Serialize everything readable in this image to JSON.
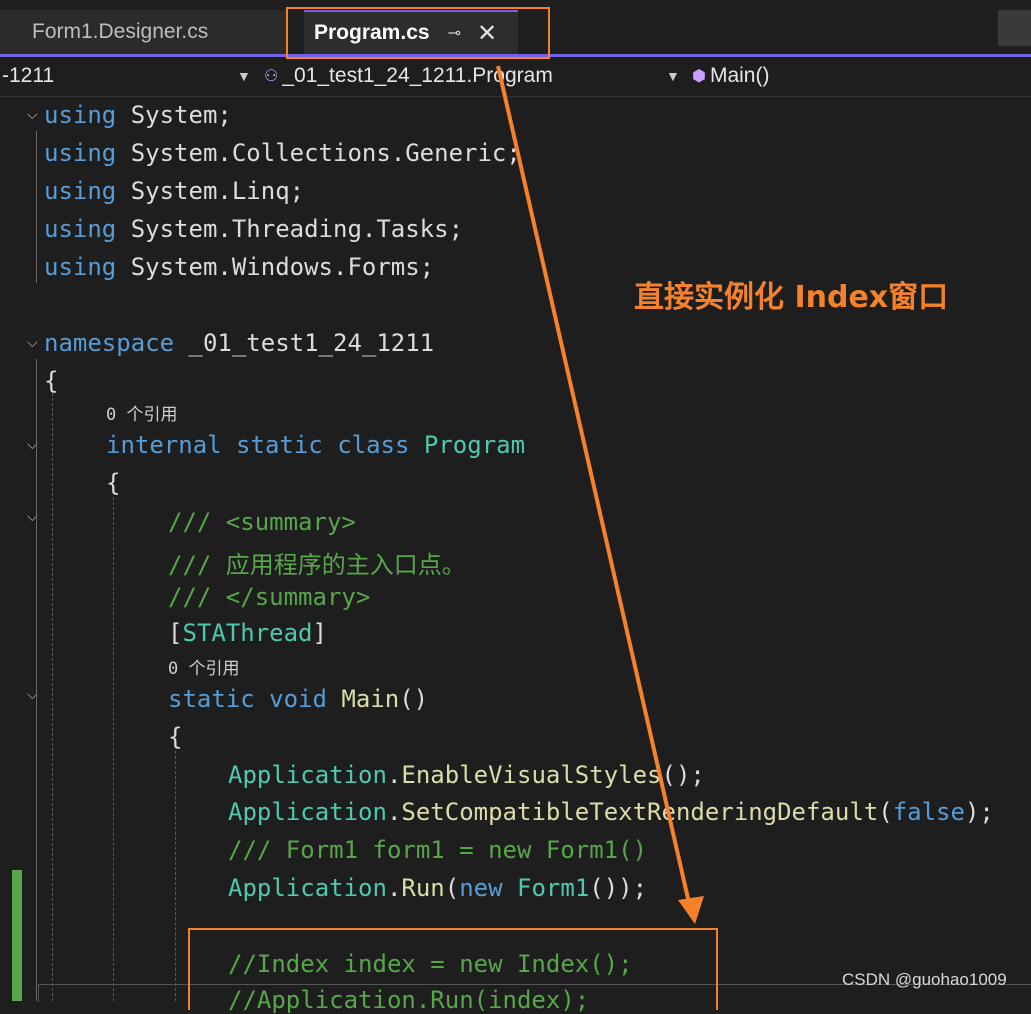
{
  "tabs": [
    {
      "label": "Form1.Designer.cs",
      "active": false
    },
    {
      "label": "Program.cs",
      "active": true,
      "pin_glyph": "⊸",
      "close_glyph": "✕"
    }
  ],
  "navbar": {
    "project": "-1211",
    "class_name": "_01_test1_24_1211.Program",
    "member": "Main()"
  },
  "code": {
    "l1_kw": "using",
    "l1_rest": " System;",
    "l2_kw": "using",
    "l2_rest": " System.Collections.Generic;",
    "l3_kw": "using",
    "l3_rest": " System.Linq;",
    "l4_kw": "using",
    "l4_rest": " System.Threading.Tasks;",
    "l5_kw": "using",
    "l5_rest": " System.Windows.Forms;",
    "ns_kw": "namespace",
    "ns_name": " _01_test1_24_1211",
    "brace_open": "{",
    "codelens_class": "0 个引用",
    "class_kw": "internal static class",
    "class_name": "Program",
    "class_brace": "{",
    "doc1": "/// <summary>",
    "doc2": "/// 应用程序的主入口点。",
    "doc3": "/// </summary>",
    "attr_open": "[",
    "attr_name": "STAThread",
    "attr_close": "]",
    "codelens_main": "0 个引用",
    "main_kw": "static void",
    "main_name": "Main",
    "main_parens": "()",
    "main_brace": "{",
    "s1_type": "Application",
    "s1_dot": ".",
    "s1_fn": "EnableVisualStyles",
    "s1_end": "();",
    "s2_type": "Application",
    "s2_dot": ".",
    "s2_fn": "SetCompatibleTextRenderingDefault",
    "s2_open": "(",
    "s2_arg": "false",
    "s2_end": ");",
    "s3_comment": "/// Form1 form1 = new Form1()",
    "s4_type": "Application",
    "s4_dot": ".",
    "s4_fn": "Run",
    "s4_open": "(",
    "s4_new": "new",
    "s4_form": " Form1",
    "s4_end": "());",
    "s5_comment": "//Index index = new Index();",
    "s6_comment": "//Application.Run(index);"
  },
  "annotation": "直接实例化 Index窗口",
  "watermark": "CSDN @guohao1009",
  "colors": {
    "accent": "#7160e8",
    "highlight": "#f5822a",
    "keyword": "#569cd6",
    "type": "#4ec9b0",
    "comment": "#57a64a",
    "method": "#dcdcaa"
  }
}
